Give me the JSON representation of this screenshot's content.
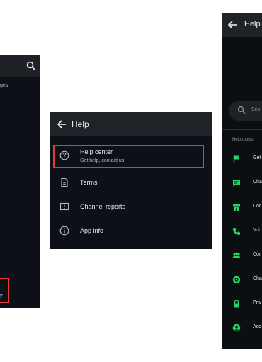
{
  "left_panel": {
    "fragment_top": "ges",
    "fragment_bottom": "y"
  },
  "middle_panel": {
    "title": "Help",
    "items": [
      {
        "label": "Help center",
        "sublabel": "Get help, contact us"
      },
      {
        "label": "Terms"
      },
      {
        "label": "Channel reports"
      },
      {
        "label": "App info"
      }
    ]
  },
  "right_panel": {
    "title": "Help",
    "search_placeholder": "Ses",
    "section_label": "Help topics",
    "topics": [
      {
        "label": "Get",
        "icon": "flag-icon"
      },
      {
        "label": "Cha",
        "icon": "chat-icon"
      },
      {
        "label": "Cor",
        "icon": "store-icon"
      },
      {
        "label": "Voi",
        "icon": "phone-icon"
      },
      {
        "label": "Cor",
        "icon": "group-icon"
      },
      {
        "label": "Cha",
        "icon": "channel-icon"
      },
      {
        "label": "Priv",
        "icon": "lock-icon"
      },
      {
        "label": "Acc",
        "icon": "account-icon"
      }
    ]
  },
  "colors": {
    "panel_bg": "#0d1117",
    "accent_green": "#25d366",
    "highlight_red": "#e53935"
  }
}
